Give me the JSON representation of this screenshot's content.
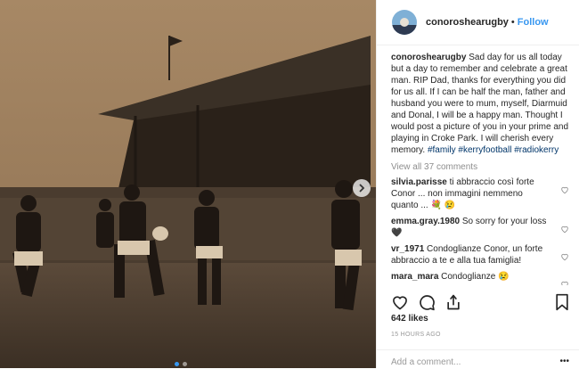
{
  "post": {
    "username": "conoroshearugby",
    "follow_label": "Follow",
    "separator": "•",
    "caption_user": "conoroshearugby",
    "caption_text": " Sad day for us all today but a day to remember and celebrate a great man. RIP Dad, thanks for everything you did for us all. If I can be half the man, father and husband you were to mum, myself, Diarmuid and Donal, I will be a happy man. Thought I would post a picture of you in your prime and playing in Croke Park. I will cherish every memory. ",
    "hashtags": [
      "#family",
      "#kerryfootball",
      "#radiokerry"
    ],
    "view_all": "View all 37 comments",
    "comments": [
      {
        "user": "silvia.parisse",
        "text": " ti abbraccio così forte Conor ... non immagini nemmeno quanto ... 💐 😢"
      },
      {
        "user": "emma.gray.1980",
        "text": " So sorry for your loss 🖤"
      },
      {
        "user": "vr_1971",
        "text": " Condoglianze Conor, un forte abbraccio a te e alla tua famiglia!"
      },
      {
        "user": "mara_mara",
        "text": " Condoglianze 😢"
      }
    ],
    "likes": "642 likes",
    "time": "15 HOURS AGO",
    "add_comment_placeholder": "Add a comment...",
    "more": "•••"
  },
  "icons": {
    "next": "chevron-right-icon",
    "like": "heart-icon",
    "comment": "comment-icon",
    "share": "share-icon",
    "save": "bookmark-icon"
  },
  "colors": {
    "accent": "#3897f0",
    "text": "#262626",
    "muted": "#8e8e8e"
  }
}
